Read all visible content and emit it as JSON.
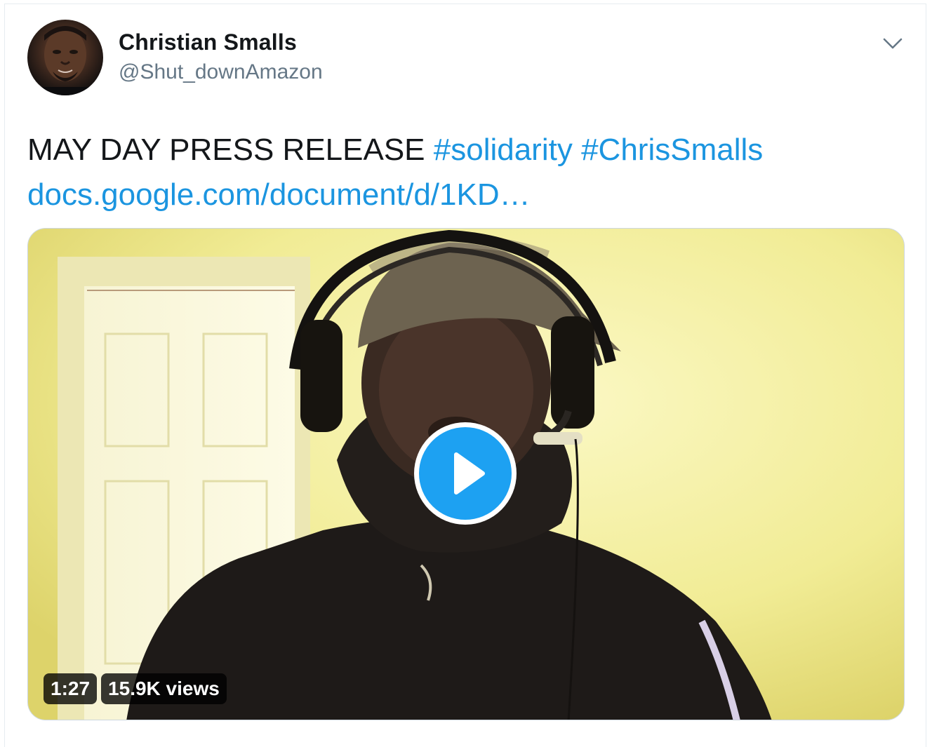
{
  "tweet": {
    "author": {
      "display_name": "Christian Smalls",
      "handle": "@Shut_downAmazon"
    },
    "text": {
      "plain": "MAY DAY PRESS RELEASE ",
      "hashtags": [
        "#solidarity",
        "#ChrisSmalls"
      ],
      "link": "docs.google.com/document/d/1KD…"
    },
    "media": {
      "type": "video",
      "duration": "1:27",
      "views": "15.9K views"
    }
  },
  "icons": {
    "menu": "chevron-down-icon",
    "play": "play-icon",
    "avatar": "avatar"
  },
  "colors": {
    "link": "#1b95e0",
    "play_button": "#1da1f2",
    "text": "#14171a",
    "secondary": "#657786"
  }
}
